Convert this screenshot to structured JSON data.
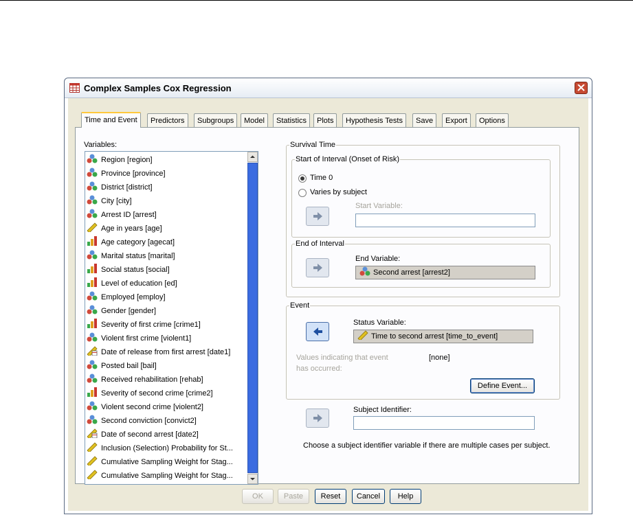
{
  "window": {
    "title": "Complex Samples Cox Regression"
  },
  "tabs": [
    {
      "label": "Time and Event",
      "active": true
    },
    {
      "label": "Predictors"
    },
    {
      "label": "Subgroups"
    },
    {
      "label": "Model"
    },
    {
      "label": "Statistics"
    },
    {
      "label": "Plots"
    },
    {
      "label": "Hypothesis Tests"
    },
    {
      "label": "Save"
    },
    {
      "label": "Export"
    },
    {
      "label": "Options"
    }
  ],
  "variables": {
    "label": "Variables:",
    "items": [
      {
        "label": "Region [region]",
        "icon": "nominal-icon"
      },
      {
        "label": "Province [province]",
        "icon": "nominal-icon"
      },
      {
        "label": "District [district]",
        "icon": "nominal-icon"
      },
      {
        "label": "City [city]",
        "icon": "nominal-icon"
      },
      {
        "label": "Arrest ID [arrest]",
        "icon": "nominal-icon"
      },
      {
        "label": "Age in years [age]",
        "icon": "scale-icon"
      },
      {
        "label": "Age category [agecat]",
        "icon": "ordinal-icon"
      },
      {
        "label": "Marital status [marital]",
        "icon": "nominal-icon"
      },
      {
        "label": "Social status [social]",
        "icon": "ordinal-icon"
      },
      {
        "label": "Level of education [ed]",
        "icon": "ordinal-icon"
      },
      {
        "label": "Employed [employ]",
        "icon": "nominal-icon"
      },
      {
        "label": "Gender [gender]",
        "icon": "nominal-icon"
      },
      {
        "label": "Severity of first crime [crime1]",
        "icon": "ordinal-icon"
      },
      {
        "label": "Violent first crime [violent1]",
        "icon": "nominal-icon"
      },
      {
        "label": "Date of release from first arrest [date1]",
        "icon": "date-icon"
      },
      {
        "label": "Posted bail [bail]",
        "icon": "nominal-icon"
      },
      {
        "label": "Received rehabilitation [rehab]",
        "icon": "nominal-icon"
      },
      {
        "label": "Severity of second crime [crime2]",
        "icon": "ordinal-icon"
      },
      {
        "label": "Violent second crime [violent2]",
        "icon": "nominal-icon"
      },
      {
        "label": "Second conviction [convict2]",
        "icon": "nominal-icon"
      },
      {
        "label": "Date of second arrest [date2]",
        "icon": "date-icon"
      },
      {
        "label": "Inclusion (Selection) Probability for St...",
        "icon": "scale-icon"
      },
      {
        "label": "Cumulative Sampling Weight for Stag...",
        "icon": "scale-icon"
      },
      {
        "label": "Cumulative Sampling Weight for Stag...",
        "icon": "scale-icon"
      }
    ]
  },
  "survival_time": {
    "legend": "Survival Time",
    "start": {
      "legend": "Start of Interval (Onset of Risk)",
      "option_time0": "Time 0",
      "option_varies": "Varies by subject",
      "selected": "Time 0",
      "start_variable_label": "Start Variable:",
      "start_variable_value": ""
    },
    "end": {
      "legend": "End of Interval",
      "end_variable_label": "End Variable:",
      "end_variable_value": "Second arrest [arrest2]"
    }
  },
  "event": {
    "legend": "Event",
    "status_variable_label": "Status Variable:",
    "status_variable_value": "Time to second arrest [time_to_event]",
    "values_label_line1": "Values indicating that event",
    "values_label_line2": "has occurred:",
    "values_value": "[none]",
    "define_button": "Define Event..."
  },
  "subject": {
    "label": "Subject Identifier:",
    "value": "",
    "hint": "Choose a subject identifier variable if there are multiple cases per subject."
  },
  "buttons": {
    "ok": "OK",
    "paste": "Paste",
    "reset": "Reset",
    "cancel": "Cancel",
    "help": "Help"
  },
  "colors": {
    "nominal": "#d04a3c",
    "scale": "#e0c020",
    "ordinal": "#c8372d",
    "active_arrow": "#1e4fa0",
    "scrollbar": "#3a6ce0"
  }
}
